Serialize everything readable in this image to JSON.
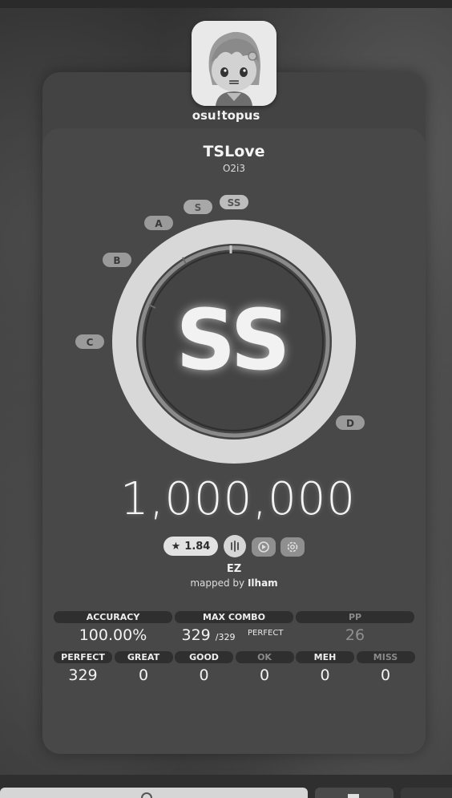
{
  "user": {
    "name": "osu!topus",
    "avatar_icon": "cartoon-girl-avatar"
  },
  "song": {
    "title": "TSLove",
    "artist": "O2i3"
  },
  "rank": {
    "achieved": "SS",
    "markers": [
      "SS",
      "S",
      "A",
      "B",
      "C",
      "D"
    ],
    "accuracy_fill": 1.0
  },
  "score": "1,000,000",
  "beatmap": {
    "star_rating": "1.84",
    "star_icon": "star-icon",
    "ruleset_icon": "mania-ruleset-icon",
    "mods": [
      "autoplay-mod-icon",
      "customise-mod-icon"
    ],
    "difficulty": "EZ",
    "mapped_by_label": "mapped by",
    "mapper": "Ilham"
  },
  "stats": {
    "accuracy_label": "ACCURACY",
    "accuracy_value": "100.00%",
    "max_combo_label": "MAX COMBO",
    "max_combo_value": "329",
    "max_combo_total": "/329",
    "max_combo_flag": "PERFECT",
    "pp_label": "PP",
    "pp_value": "26"
  },
  "judgements": [
    {
      "label": "PERFECT",
      "value": "329",
      "dim": false
    },
    {
      "label": "GREAT",
      "value": "0",
      "dim": false
    },
    {
      "label": "GOOD",
      "value": "0",
      "dim": false
    },
    {
      "label": "OK",
      "value": "0",
      "dim": true
    },
    {
      "label": "MEH",
      "value": "0",
      "dim": false
    },
    {
      "label": "MISS",
      "value": "0",
      "dim": true
    }
  ],
  "colors": {
    "ring": "#d9d9d9",
    "panel": "#484848",
    "pill": "#e2e2e2",
    "label_bg": "#2f2f2f"
  }
}
